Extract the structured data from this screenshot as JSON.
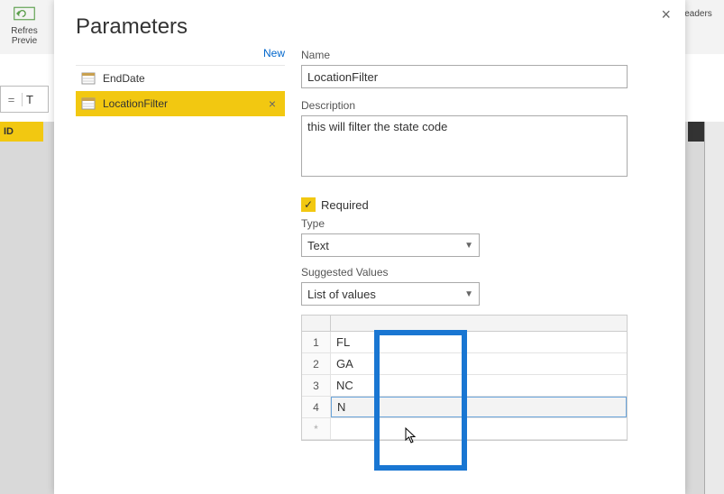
{
  "ribbon": {
    "refresh_label": "Refres",
    "preview_label": "Previe",
    "headers_label": "leaders"
  },
  "formula": {
    "eq": "=",
    "text": "T"
  },
  "column_header": "ID",
  "dialog": {
    "title": "Parameters",
    "new_label": "New",
    "params": [
      {
        "label": "EndDate",
        "selected": false
      },
      {
        "label": "LocationFilter",
        "selected": true
      }
    ],
    "name_label": "Name",
    "name_value": "LocationFilter",
    "desc_label": "Description",
    "desc_value": "this will filter the state code",
    "required_label": "Required",
    "required_checked": true,
    "type_label": "Type",
    "type_value": "Text",
    "suggested_label": "Suggested Values",
    "suggested_value": "List of values",
    "values": [
      {
        "n": "1",
        "v": "FL"
      },
      {
        "n": "2",
        "v": "GA"
      },
      {
        "n": "3",
        "v": "NC"
      },
      {
        "n": "4",
        "v": "N",
        "editing": true
      }
    ],
    "new_row_marker": "*"
  }
}
